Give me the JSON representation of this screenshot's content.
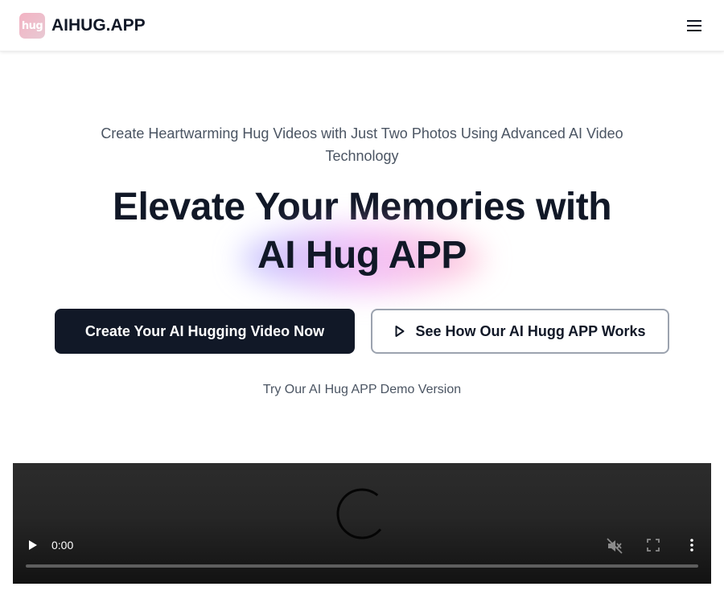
{
  "header": {
    "logo_text": "hug",
    "brand": "AIHUG.APP",
    "menu_icon": "hamburger-menu-icon"
  },
  "hero": {
    "subtitle": "Create Heartwarming Hug Videos with Just Two Photos Using Advanced AI Video Technology",
    "headline_line1": "Elevate Your Memories with",
    "headline_line2": "AI Hug APP",
    "primary_button": "Create Your AI Hugging Video Now",
    "secondary_button": "See How Our AI Hugg APP Works",
    "secondary_button_icon": "play-outline-icon",
    "demo_link": "Try Our AI Hug APP Demo Version"
  },
  "video": {
    "time": "0:00",
    "progress": 0,
    "icons": [
      "play-icon",
      "muted-icon",
      "fullscreen-icon",
      "more-options-icon",
      "loading-spinner-icon"
    ]
  },
  "colors": {
    "primary_button_bg": "#111827",
    "text_dark": "#111827",
    "text_muted": "#4b5563",
    "secondary_border": "#9ca3af",
    "logo_bg": "#f3b3c3"
  }
}
